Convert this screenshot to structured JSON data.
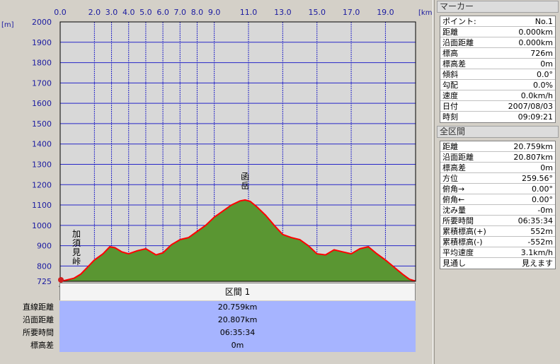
{
  "chart_data": {
    "type": "area",
    "xlabel": "km",
    "ylabel": "m",
    "xlim": [
      0,
      20.76
    ],
    "ylim": [
      725,
      2000
    ],
    "x_ticks": [
      0.0,
      2.0,
      3.0,
      4.0,
      5.0,
      6.0,
      7.0,
      8.0,
      9.0,
      11.0,
      13.0,
      15.0,
      17.0,
      19.0
    ],
    "x_tick_labels": [
      "0.0",
      "2.0",
      "3.0",
      "4.0",
      "5.0",
      "6.0",
      "7.0",
      "8.0",
      "9.0",
      "11.0",
      "13.0",
      "15.0",
      "17.0",
      "19.0"
    ],
    "y_ticks": [
      725,
      800,
      900,
      1000,
      1100,
      1200,
      1300,
      1400,
      1500,
      1600,
      1700,
      1800,
      1900,
      2000
    ],
    "y_tick_labels": [
      "725",
      "800",
      "900",
      "1000",
      "1100",
      "1200",
      "1300",
      "1400",
      "1500",
      "1600",
      "1700",
      "1800",
      "1900",
      "2000"
    ],
    "x_unit_label": "[km]",
    "y_unit_label": "[m]",
    "grid": true,
    "fill_color": "#5a9632",
    "line_color": "#ff0000",
    "plot_bg": "#d8d8d8",
    "grid_color": "#2626c8",
    "series": [
      {
        "x": [
          0,
          0.3,
          0.8,
          1.2,
          1.6,
          2.0,
          2.5,
          2.9,
          3.2,
          3.6,
          4.0,
          4.5,
          5.0,
          5.6,
          6.0,
          6.5,
          7.0,
          7.5,
          8.0,
          8.5,
          9.0,
          9.5,
          10.0,
          10.5,
          10.8,
          11.1,
          11.5,
          12.0,
          12.5,
          13.0,
          13.5,
          14.0,
          14.5,
          15.0,
          15.5,
          16.0,
          16.5,
          17.0,
          17.5,
          18.0,
          18.5,
          19.0,
          19.5,
          20.0,
          20.4,
          20.76
        ],
        "y": [
          726,
          730,
          740,
          760,
          795,
          830,
          860,
          895,
          890,
          870,
          860,
          875,
          885,
          855,
          865,
          905,
          930,
          940,
          970,
          1000,
          1040,
          1070,
          1100,
          1120,
          1125,
          1118,
          1090,
          1050,
          1000,
          955,
          940,
          930,
          900,
          860,
          855,
          880,
          870,
          860,
          885,
          895,
          860,
          830,
          795,
          760,
          735,
          726
        ]
      }
    ],
    "annotations": [
      {
        "text": "加須見峠",
        "x": 0.95,
        "y": 830
      },
      {
        "text": "函岳",
        "x": 10.8,
        "y": 1125
      }
    ]
  },
  "section": {
    "tab_label": "区間 1",
    "rows": [
      {
        "label": "直線距離",
        "value": "20.759km"
      },
      {
        "label": "沿面距離",
        "value": "20.807km"
      },
      {
        "label": "所要時間",
        "value": "06:35:34"
      },
      {
        "label": "標高差",
        "value": "0m"
      }
    ]
  },
  "marker_panel": {
    "title": "マーカー",
    "rows": [
      {
        "label": "ポイント:",
        "value": "No.1"
      },
      {
        "label": "距離",
        "value": "0.000km"
      },
      {
        "label": "沿面距離",
        "value": "0.000km"
      },
      {
        "label": "標高",
        "value": "726m"
      },
      {
        "label": "標高差",
        "value": "0m"
      },
      {
        "label": "傾斜",
        "value": "0.0°"
      },
      {
        "label": "勾配",
        "value": "0.0%"
      },
      {
        "label": "速度",
        "value": "0.0km/h"
      },
      {
        "label": "日付",
        "value": "2007/08/03"
      },
      {
        "label": "時刻",
        "value": "09:09:21"
      }
    ]
  },
  "all_section_panel": {
    "title": "全区間",
    "rows": [
      {
        "label": "距離",
        "value": "20.759km"
      },
      {
        "label": "沿面距離",
        "value": "20.807km"
      },
      {
        "label": "標高差",
        "value": "0m"
      },
      {
        "label": "方位",
        "value": "259.56°"
      },
      {
        "label": "俯角→",
        "value": "0.00°"
      },
      {
        "label": "俯角←",
        "value": "0.00°"
      },
      {
        "label": "沈み量",
        "value": "-0m"
      },
      {
        "label": "所要時間",
        "value": "06:35:34"
      },
      {
        "label": "累積標高(+)",
        "value": "552m"
      },
      {
        "label": "累積標高(-)",
        "value": "-552m"
      },
      {
        "label": "平均速度",
        "value": "3.1km/h"
      },
      {
        "label": "見通し",
        "value": "見えます"
      }
    ]
  }
}
